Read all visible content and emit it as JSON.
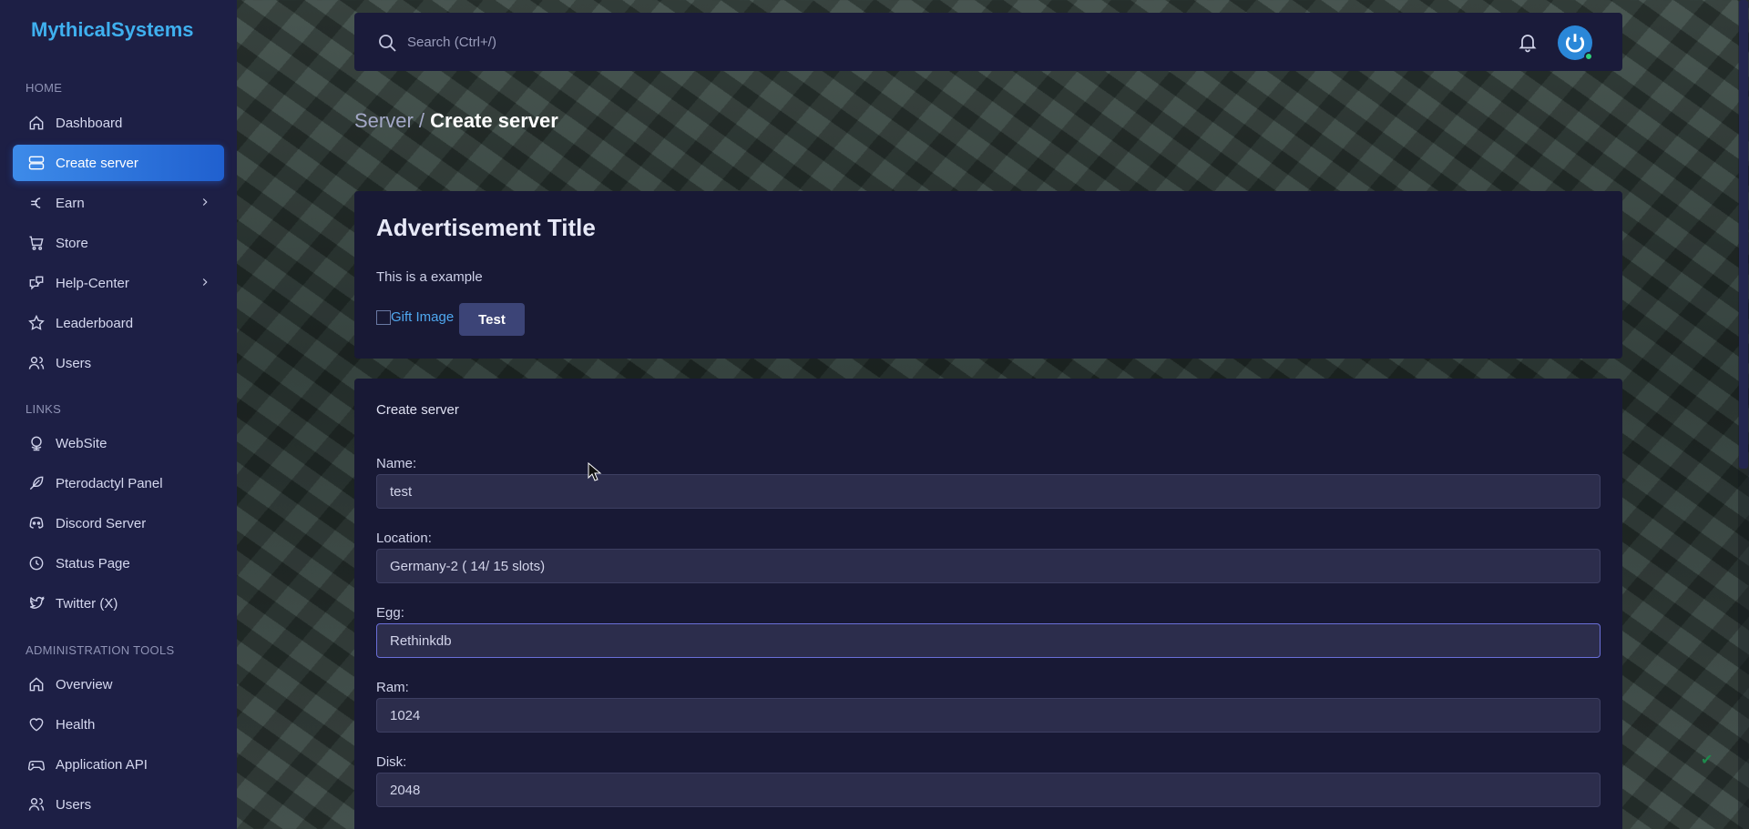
{
  "brand": "MythicalSystems",
  "sections": {
    "home": "HOME",
    "links": "LINKS",
    "admin": "ADMINISTRATION TOOLS"
  },
  "nav": {
    "home": [
      {
        "label": "Dashboard",
        "icon": "home-icon"
      },
      {
        "label": "Create server",
        "icon": "server-icon",
        "active": true
      },
      {
        "label": "Earn",
        "icon": "euro-icon",
        "has_submenu": true
      },
      {
        "label": "Store",
        "icon": "cart-icon"
      },
      {
        "label": "Help-Center",
        "icon": "messages-icon",
        "has_submenu": true
      },
      {
        "label": "Leaderboard",
        "icon": "star-icon"
      },
      {
        "label": "Users",
        "icon": "users-icon"
      }
    ],
    "links": [
      {
        "label": "WebSite",
        "icon": "globe-icon"
      },
      {
        "label": "Pterodactyl Panel",
        "icon": "feather-icon"
      },
      {
        "label": "Discord Server",
        "icon": "discord-icon"
      },
      {
        "label": "Status Page",
        "icon": "clock-icon"
      },
      {
        "label": "Twitter (X)",
        "icon": "twitter-icon"
      }
    ],
    "admin": [
      {
        "label": "Overview",
        "icon": "home-icon"
      },
      {
        "label": "Health",
        "icon": "heart-icon"
      },
      {
        "label": "Application API",
        "icon": "gamepad-icon"
      },
      {
        "label": "Users",
        "icon": "users-icon"
      }
    ]
  },
  "topbar": {
    "search_placeholder": "Search (Ctrl+/)"
  },
  "breadcrumb": {
    "parent": "Server / ",
    "current": "Create server"
  },
  "ad": {
    "title": "Advertisement Title",
    "text": "This is a example",
    "image_alt": "Gift Image",
    "button": "Test"
  },
  "form": {
    "title": "Create server",
    "fields": {
      "name": {
        "label": "Name:",
        "value": "test"
      },
      "location": {
        "label": "Location:",
        "value": "Germany-2 ( 14/ 15 slots)"
      },
      "egg": {
        "label": "Egg:",
        "value": "Rethinkdb"
      },
      "ram": {
        "label": "Ram:",
        "value": "1024"
      },
      "disk": {
        "label": "Disk:",
        "value": "2048"
      }
    }
  },
  "colors": {
    "sidebar_bg": "#1d1f45",
    "brand": "#3fb0ef",
    "active_item": "#3d8be9",
    "card_bg": "#181935"
  }
}
